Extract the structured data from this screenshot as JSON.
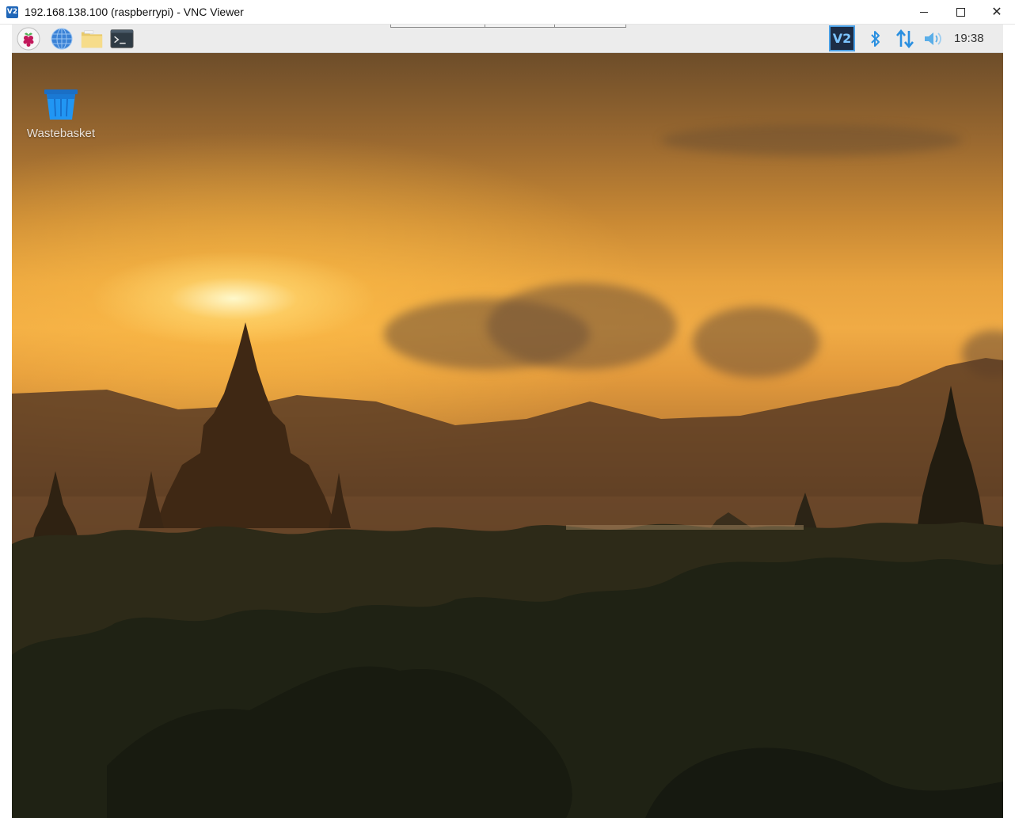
{
  "window": {
    "title": "192.168.138.100 (raspberrypi) - VNC Viewer",
    "app_icon": "V2",
    "controls": {
      "minimize": "minimize-icon",
      "maximize": "maximize-icon",
      "close": "close-icon"
    }
  },
  "panel": {
    "launchers": [
      {
        "name": "Raspberry Pi menu",
        "icon": "raspberry-icon"
      },
      {
        "name": "Web Browser",
        "icon": "globe-icon"
      },
      {
        "name": "File Manager",
        "icon": "folder-icon"
      },
      {
        "name": "Terminal",
        "icon": "terminal-icon"
      }
    ],
    "tray": {
      "vnc_label": "V2",
      "bluetooth": "bluetooth-icon",
      "network": "network-arrows-icon",
      "volume": "volume-icon",
      "clock": "19:38"
    }
  },
  "desktop": {
    "icons": [
      {
        "label": "Wastebasket",
        "icon": "trash-icon"
      }
    ],
    "wallpaper": "sunset-temples"
  },
  "colors": {
    "vnc_accent": "#4aa0e6",
    "panel_bg": "#ececec",
    "tray_blue": "#2a8fe0"
  }
}
